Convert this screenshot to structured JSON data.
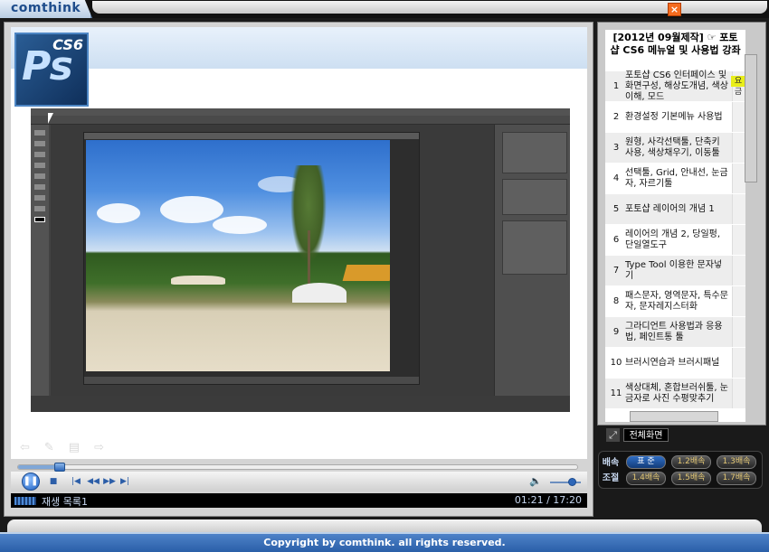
{
  "brand": {
    "name": "comthink"
  },
  "window": {
    "close_icon": "close-icon",
    "close_glyph": "×"
  },
  "video": {
    "logo": {
      "letters": "Ps",
      "version": "CS6"
    },
    "faded_icons": "⇦✎▤⇨"
  },
  "player": {
    "progress_fraction": 0.074,
    "controls": {
      "pause_glyph": "❚❚",
      "stop_glyph": "■",
      "prev_glyph": "|◀",
      "rewind_glyph": "◀◀",
      "forward_glyph": "▶▶",
      "next_glyph": "▶|",
      "volume_glyph": "🔈"
    },
    "volume_fraction": 0.7,
    "status_label": "재생 목록1",
    "time": "01:21 / 17:20"
  },
  "sidebar": {
    "course_title": "[2012년 09월제작] ☞ 포토샵 CS6 메뉴얼 및 사용법 강좌",
    "current_badge": "요금",
    "lessons": [
      {
        "num": "1",
        "title": "포토샵 CS6 인터페이스 및 화면구성, 해상도개념, 색상이해, 모드"
      },
      {
        "num": "2",
        "title": "환경설정 기본메뉴 사용법"
      },
      {
        "num": "3",
        "title": "원형, 사각선택툴, 단축키 사용, 색상채우기, 이동툴"
      },
      {
        "num": "4",
        "title": "선택툴, Grid, 안내선, 눈금자, 자르기툴"
      },
      {
        "num": "5",
        "title": "포토샵 레이어의 개념 1"
      },
      {
        "num": "6",
        "title": "레이어의 개념 2, 당일펑, 단일열도구"
      },
      {
        "num": "7",
        "title": "Type Tool 이용한 문자넣기"
      },
      {
        "num": "8",
        "title": "패스문자, 영역문자, 특수문자, 문자레지스터화"
      },
      {
        "num": "9",
        "title": "그라디언트 사용법과 응용법, 페인트통 툴"
      },
      {
        "num": "10",
        "title": "브러시연습과 브러시패널"
      },
      {
        "num": "11",
        "title": "색상대체, 혼합브러쉬툴, 눈금자로 사진 수평맞추기"
      }
    ],
    "fullscreen_label": "전체화면",
    "fullscreen_icon": "⤢"
  },
  "speed": {
    "title_line1": "배속",
    "title_line2": "조절",
    "buttons": [
      "표 준",
      "1.2배속",
      "1.3배속",
      "1.4배속",
      "1.5배속",
      "1.7배속"
    ]
  },
  "footer": {
    "copyright": "Copyright by comthink. all rights reserved."
  }
}
